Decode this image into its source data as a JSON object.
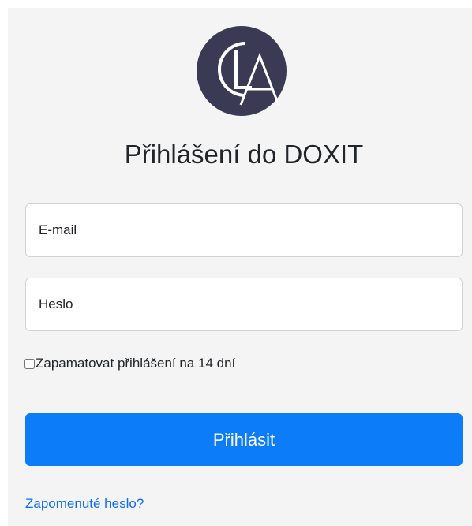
{
  "brand": {
    "logo_icon": "cla-logo-icon",
    "logo_color": "#3b3a55"
  },
  "login": {
    "title": "Přihlášení do DOXIT",
    "email_placeholder": "E-mail",
    "password_placeholder": "Heslo",
    "remember_label": "Zapamatovat přihlášení na 14 dní",
    "remember_checked": false,
    "submit_label": "Přihlásit",
    "forgot_link": "Zapomenuté heslo?"
  },
  "colors": {
    "primary": "#0d7cf8",
    "link": "#0d6efd",
    "panel_background": "#f4f4f4"
  }
}
